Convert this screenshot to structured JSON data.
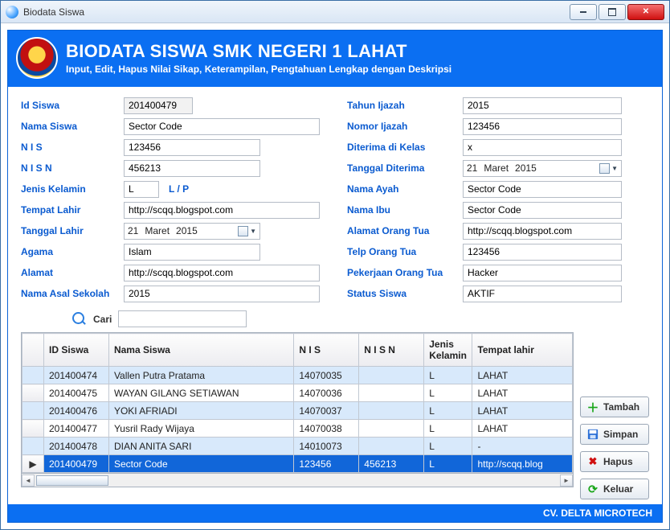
{
  "window": {
    "title": "Biodata Siswa"
  },
  "header": {
    "title": "BIODATA SISWA SMK NEGERI 1 LAHAT",
    "subtitle": "Input, Edit, Hapus Nilai Sikap, Keterampilan, Pengtahuan Lengkap dengan Deskripsi"
  },
  "labels_left": {
    "id_siswa": "Id Siswa",
    "nama_siswa": "Nama Siswa",
    "nis": "N I S",
    "nisn": "N I S N",
    "jk": "Jenis Kelamin",
    "jk_hint": "L / P",
    "tempat_lahir": "Tempat Lahir",
    "tgl_lahir": "Tanggal Lahir",
    "agama": "Agama",
    "alamat": "Alamat",
    "asal_sekolah": "Nama Asal Sekolah"
  },
  "labels_right": {
    "thn_ijazah": "Tahun Ijazah",
    "no_ijazah": "Nomor Ijazah",
    "diterima": "Diterima di Kelas",
    "tgl_diterima": "Tanggal Diterima",
    "nama_ayah": "Nama Ayah",
    "nama_ibu": "Nama Ibu",
    "alamat_ortu": "Alamat Orang Tua",
    "telp_ortu": "Telp Orang Tua",
    "pekerjaan_ortu": "Pekerjaan Orang Tua",
    "status": "Status Siswa"
  },
  "values": {
    "id_siswa": "201400479",
    "nama_siswa": "Sector Code",
    "nis": "123456",
    "nisn": "456213",
    "jk": "L",
    "tempat_lahir": "http://scqq.blogspot.com",
    "tgl_lahir": {
      "d": "21",
      "m": "Maret",
      "y": "2015"
    },
    "agama": "Islam",
    "alamat": "http://scqq.blogspot.com",
    "asal_sekolah": "2015",
    "thn_ijazah": "2015",
    "no_ijazah": "123456",
    "diterima": "x",
    "tgl_diterima": {
      "d": "21",
      "m": "Maret",
      "y": "2015"
    },
    "nama_ayah": "Sector Code",
    "nama_ibu": "Sector Code",
    "alamat_ortu": "http://scqq.blogspot.com",
    "telp_ortu": "123456",
    "pekerjaan_ortu": "Hacker",
    "status": "AKTIF"
  },
  "search": {
    "label": "Cari",
    "value": ""
  },
  "grid": {
    "headers": {
      "id": "ID Siswa",
      "nama": "Nama Siswa",
      "nis": "N I S",
      "nisn": "N I S N",
      "jk": "Jenis Kelamin",
      "tl": "Tempat lahir"
    },
    "rows": [
      {
        "id": "201400474",
        "nama": "Vallen Putra Pratama",
        "nis": "14070035",
        "nisn": "",
        "jk": "L",
        "tl": "LAHAT"
      },
      {
        "id": "201400475",
        "nama": "WAYAN GILANG SETIAWAN",
        "nis": "14070036",
        "nisn": "",
        "jk": "L",
        "tl": "LAHAT"
      },
      {
        "id": "201400476",
        "nama": "YOKI AFRIADI",
        "nis": "14070037",
        "nisn": "",
        "jk": "L",
        "tl": "LAHAT"
      },
      {
        "id": "201400477",
        "nama": "Yusril Rady Wijaya",
        "nis": "14070038",
        "nisn": "",
        "jk": "L",
        "tl": "LAHAT"
      },
      {
        "id": "201400478",
        "nama": "DIAN ANITA SARI",
        "nis": "14010073",
        "nisn": "",
        "jk": "L",
        "tl": "-"
      },
      {
        "id": "201400479",
        "nama": "Sector Code",
        "nis": "123456",
        "nisn": "456213",
        "jk": "L",
        "tl": "http://scqq.blog"
      }
    ],
    "selected_index": 5
  },
  "actions": {
    "tambah": "Tambah",
    "simpan": "Simpan",
    "hapus": "Hapus",
    "keluar": "Keluar"
  },
  "footer": "CV. DELTA MICROTECH"
}
